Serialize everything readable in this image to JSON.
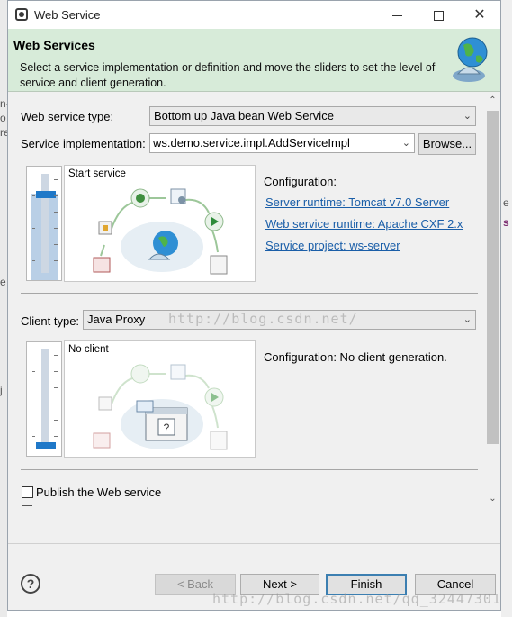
{
  "window": {
    "title": "Web Service",
    "min_icon": "minimize-icon",
    "max_icon": "maximize-icon",
    "close_glyph": "✕"
  },
  "background_fragments": [
    "n-",
    "o",
    "re",
    "e",
    "s",
    "j",
    "e"
  ],
  "banner": {
    "title": "Web Services",
    "description": "Select a service implementation or definition and move the sliders to set the level of service and client generation.",
    "icon": "globe-icon"
  },
  "service": {
    "type_label": "Web service type:",
    "type_value": "Bottom up Java bean Web Service",
    "impl_label": "Service implementation:",
    "impl_value": "ws.demo.service.impl.AddServiceImpl",
    "browse_label": "Browse...",
    "slider_level": "Start service",
    "config_label": "Configuration:",
    "links": [
      "Server runtime: Tomcat v7.0 Server",
      "Web service runtime: Apache CXF 2.x",
      "Service project: ws-server"
    ]
  },
  "client": {
    "type_label": "Client type:",
    "type_value": "Java Proxy",
    "slider_level": "No client",
    "config_label": "Configuration: No client generation."
  },
  "publish": {
    "label": "Publish the Web service",
    "checked": false
  },
  "buttons": {
    "help": "?",
    "back": "< Back",
    "next": "Next >",
    "finish": "Finish",
    "cancel": "Cancel"
  },
  "watermarks": {
    "middle": "http://blog.csdn.net/",
    "bottom": "http://blog.csdn.net/qq_32447301"
  },
  "colors": {
    "banner_bg": "#d7ebd9",
    "slider_thumb": "#1f78c8",
    "link": "#1a5ea8"
  }
}
